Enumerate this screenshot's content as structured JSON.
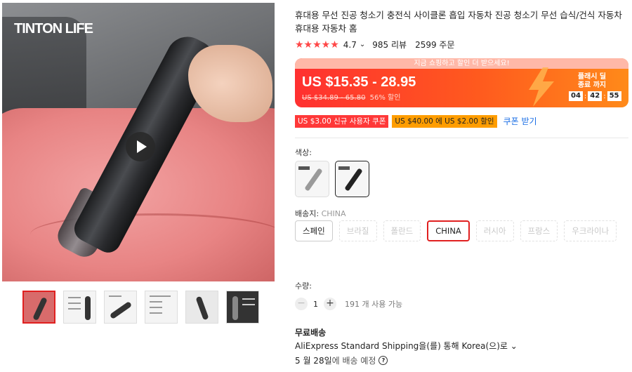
{
  "gallery": {
    "brand_logo": "TINTON LIFE",
    "play_icon": "play-icon",
    "thumbnails": [
      "thumb-1",
      "thumb-2",
      "thumb-3",
      "thumb-4",
      "thumb-5",
      "thumb-6"
    ]
  },
  "product": {
    "title": "휴대용 무선 진공 청소기 충전식 사이클론 흡입 자동차 진공 청소기 무선 습식/건식 자동차 휴대용 자동차 홈",
    "rating": "4.7",
    "rating_arrow": "⌄",
    "reviews": "985 리뷰",
    "orders": "2599 주문"
  },
  "deal": {
    "top_text": "지금 쇼핑하고 할인 더 받으세요!",
    "price": "US $15.35 - 28.95",
    "old_price": "US $34.89 - 65.80",
    "discount": "56% 할인",
    "flash_label": "플래시 딜\n종료 까지",
    "timer": [
      "04",
      "42",
      "55"
    ],
    "accent": "#ff3030"
  },
  "coupons": {
    "new_user": "US $3.00 신규 사용자 쿠폰",
    "threshold": "US $40.00 에 US $2.00 할인",
    "get": "쿠폰 받기"
  },
  "color": {
    "label": "색상:"
  },
  "shipping_from": {
    "label": "배송지: ",
    "selected": "CHINA",
    "options": [
      {
        "label": "스페인",
        "state": "normal"
      },
      {
        "label": "브라질",
        "state": "disabled"
      },
      {
        "label": "폴란드",
        "state": "disabled"
      },
      {
        "label": "CHINA",
        "state": "selected"
      },
      {
        "label": "러시아",
        "state": "disabled"
      },
      {
        "label": "프랑스",
        "state": "disabled"
      },
      {
        "label": "우크라이나",
        "state": "disabled"
      }
    ]
  },
  "quantity": {
    "label": "수량:",
    "minus": "−",
    "value": "1",
    "plus": "+",
    "available": "191 개 사용 가능"
  },
  "delivery": {
    "free": "무료배송",
    "method": "AliExpress Standard Shipping을(를) 통해 Korea(으)로 ⌄",
    "date": "5 월 28일",
    "eta_suffix": "에 배송 예정",
    "help": "?"
  }
}
